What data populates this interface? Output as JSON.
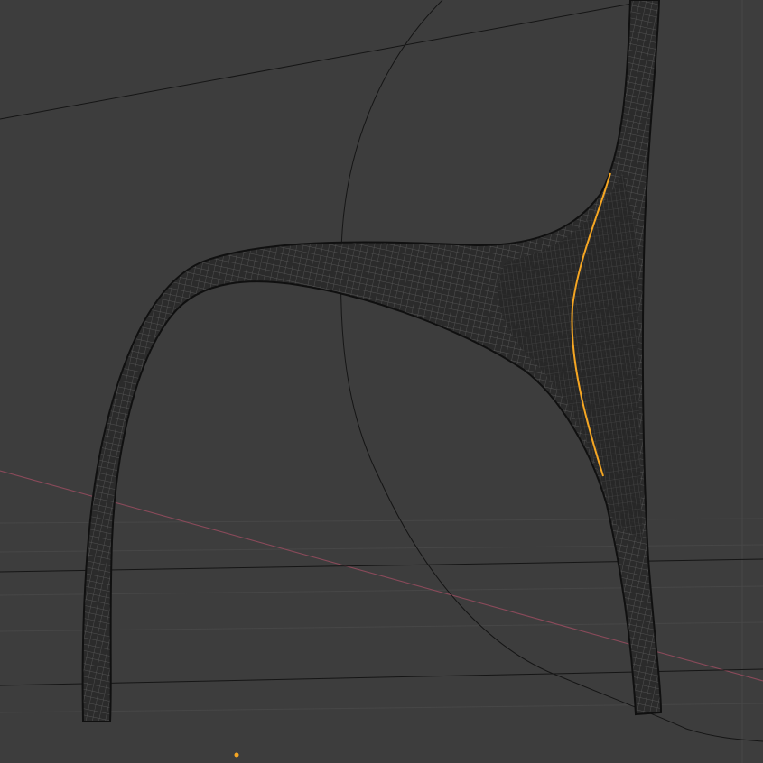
{
  "viewport": {
    "background_color": "#3d3d3d",
    "grid_color": "#474747",
    "x_axis_color": "#8a4a5a",
    "wire_color": "#151515",
    "selection_color": "#f5a623",
    "mesh_fill_color": "#2a2a2a",
    "mesh_line_color": "#6a6a6a",
    "origin_marker_color": "#f5a623"
  }
}
